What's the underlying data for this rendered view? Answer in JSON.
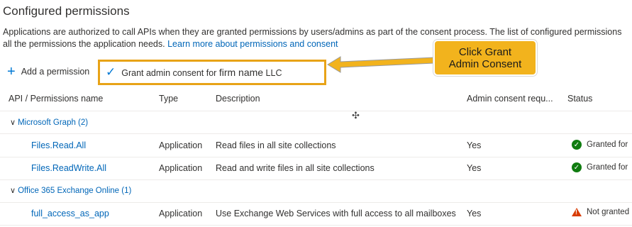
{
  "section_title": "Configured permissions",
  "description_line1": "Applications are authorized to call APIs when they are granted permissions by users/admins as part of the consent process. The list of configured permissions",
  "description_line2_prefix": "all the permissions the application needs. ",
  "learn_more_link": "Learn more about permissions and consent",
  "toolbar": {
    "add_permission_label": "Add a permission",
    "grant_consent_prefix": "Grant admin consent for ",
    "grant_consent_firm": "firm name",
    "grant_consent_suffix": " LLC"
  },
  "callout": {
    "line1": "Click Grant",
    "line2": "Admin Consent",
    "color": "#f2b31d"
  },
  "table": {
    "headers": {
      "api": "API / Permissions name",
      "type": "Type",
      "description": "Description",
      "admin_consent": "Admin consent requ...",
      "status": "Status"
    },
    "groups": [
      {
        "name": "Microsoft Graph (2)",
        "rows": [
          {
            "name": "Files.Read.All",
            "type": "Application",
            "description": "Read files in all site collections",
            "admin_consent": "Yes",
            "status": "Granted for",
            "status_icon": "check-circle-icon"
          },
          {
            "name": "Files.ReadWrite.All",
            "type": "Application",
            "description": "Read and write files in all site collections",
            "admin_consent": "Yes",
            "status": "Granted for",
            "status_icon": "check-circle-icon"
          }
        ]
      },
      {
        "name": "Office 365 Exchange Online (1)",
        "rows": [
          {
            "name": "full_access_as_app",
            "type": "Application",
            "description": "Use Exchange Web Services with full access to all mailboxes",
            "admin_consent": "Yes",
            "status": "Not granted",
            "status_icon": "warning-icon"
          }
        ]
      }
    ]
  },
  "colors": {
    "link": "#0066b8",
    "accent": "#0078d4",
    "highlight_border": "#e8a317",
    "granted": "#107c10",
    "warning": "#d83b01"
  }
}
